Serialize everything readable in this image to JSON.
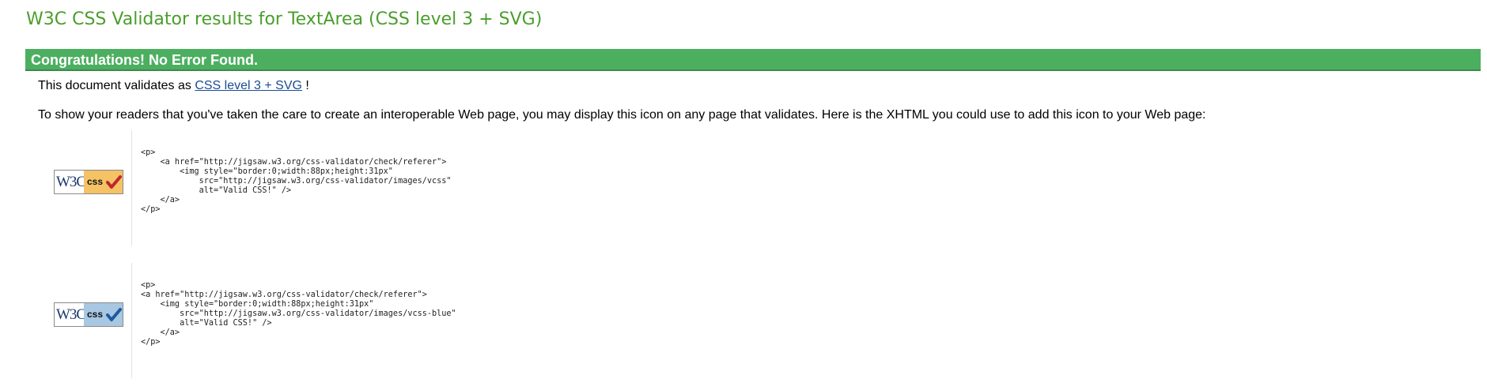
{
  "page": {
    "title": "W3C CSS Validator results for TextArea (CSS level 3 + SVG)"
  },
  "congrats": {
    "text": "Congratulations! No Error Found."
  },
  "validates": {
    "prefix": "This document validates as",
    "link_text": "CSS level 3 + SVG",
    "suffix": "!"
  },
  "info": {
    "text": "To show your readers that you've taken the care to create an interoperable Web page, you may display this icon on any page that validates. Here is the XHTML you could use to add this icon to your Web page:"
  },
  "badges": [
    {
      "logo_text": "W3C",
      "css_text": "css",
      "variant": "gold",
      "check_color": "#c0262c",
      "code": "<p>\n    <a href=\"http://jigsaw.w3.org/css-validator/check/referer\">\n        <img style=\"border:0;width:88px;height:31px\"\n            src=\"http://jigsaw.w3.org/css-validator/images/vcss\"\n            alt=\"Valid CSS!\" />\n    </a>\n</p>"
    },
    {
      "logo_text": "W3C",
      "css_text": "css",
      "variant": "blue",
      "check_color": "#1f5a9e",
      "code": "<p>\n<a href=\"http://jigsaw.w3.org/css-validator/check/referer\">\n    <img style=\"border:0;width:88px;height:31px\"\n        src=\"http://jigsaw.w3.org/css-validator/images/vcss-blue\"\n        alt=\"Valid CSS!\" />\n    </a>\n</p>"
    }
  ],
  "colors": {
    "title_green": "#4a9e2c",
    "congrats_bg": "#4caf60",
    "link_blue": "#1a4c94"
  }
}
